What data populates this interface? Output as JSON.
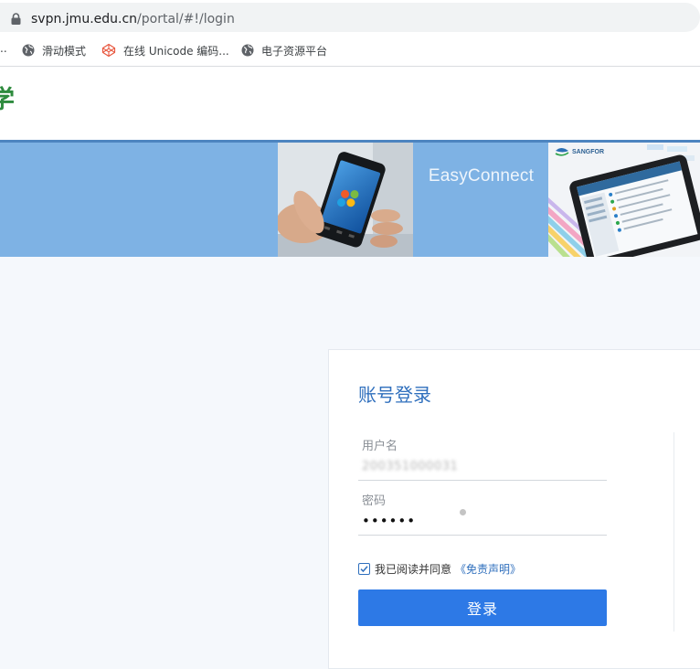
{
  "browser": {
    "url_host": "svpn.jmu.edu.cn",
    "url_path": "/portal/#!/login",
    "icons": {
      "lock": "lock-icon",
      "globe": "globe-icon",
      "codepen": "codepen-icon"
    }
  },
  "bookmarks": {
    "overflow": "..",
    "items": [
      {
        "label": "滑动模式",
        "icon": "globe-icon"
      },
      {
        "label": "在线 Unicode 编码...",
        "icon": "codepen-icon"
      },
      {
        "label": "电子资源平台",
        "icon": "globe-icon"
      }
    ]
  },
  "header": {
    "logo_fragment": "学"
  },
  "banner": {
    "brand": "EasyConnect",
    "tablet_brand": "SANGFOR"
  },
  "login": {
    "title": "账号登录",
    "username": {
      "label": "用户名",
      "value": "200351000031"
    },
    "password": {
      "label": "密码",
      "value": "••••••"
    },
    "agree": {
      "checked": true,
      "text": "我已阅读并同意",
      "link": "《免责声明》"
    },
    "submit_label": "登录"
  },
  "colors": {
    "accent": "#2d79e6",
    "title_blue": "#2f6fbd",
    "banner": "#7eb2e4",
    "banner_border": "#4d84c0",
    "logo_green": "#2e8b3e",
    "page_background": "#f5f8fc"
  }
}
